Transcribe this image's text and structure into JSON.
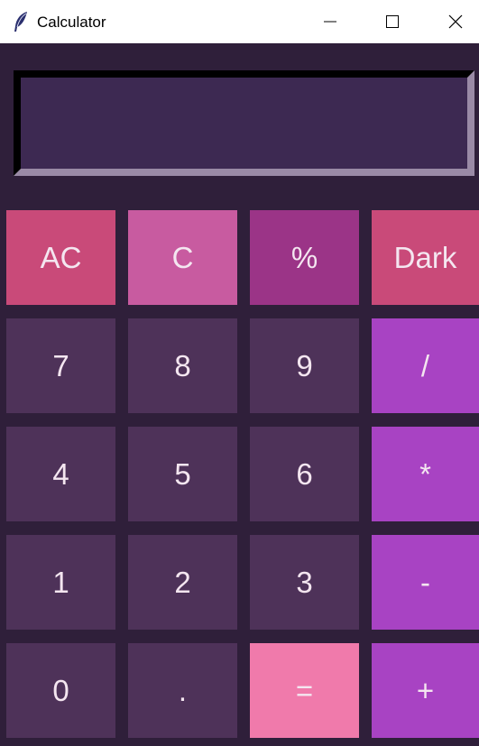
{
  "window": {
    "title": "Calculator",
    "app_icon": "feather-icon",
    "controls": [
      "minimize-icon",
      "maximize-icon",
      "close-icon"
    ]
  },
  "display": {
    "value": ""
  },
  "keys": {
    "ac": "AC",
    "c": "C",
    "percent": "%",
    "dark": "Dark",
    "seven": "7",
    "eight": "8",
    "nine": "9",
    "divide": "/",
    "four": "4",
    "five": "5",
    "six": "6",
    "multiply": "*",
    "one": "1",
    "two": "2",
    "three": "3",
    "subtract": "-",
    "zero": "0",
    "decimal": ".",
    "equals": "=",
    "add": "+"
  },
  "colors": {
    "body_background": "#2f1f3a",
    "display_background": "#3d2952",
    "number_key": "#4e3259",
    "operator_key": "#a843c3",
    "ac_key": "#c94a79",
    "c_key": "#c85ba0",
    "percent_key": "#9b3487",
    "dark_key": "#c94a79",
    "equals_key": "#f07aab",
    "key_text": "#f4e6f0"
  }
}
